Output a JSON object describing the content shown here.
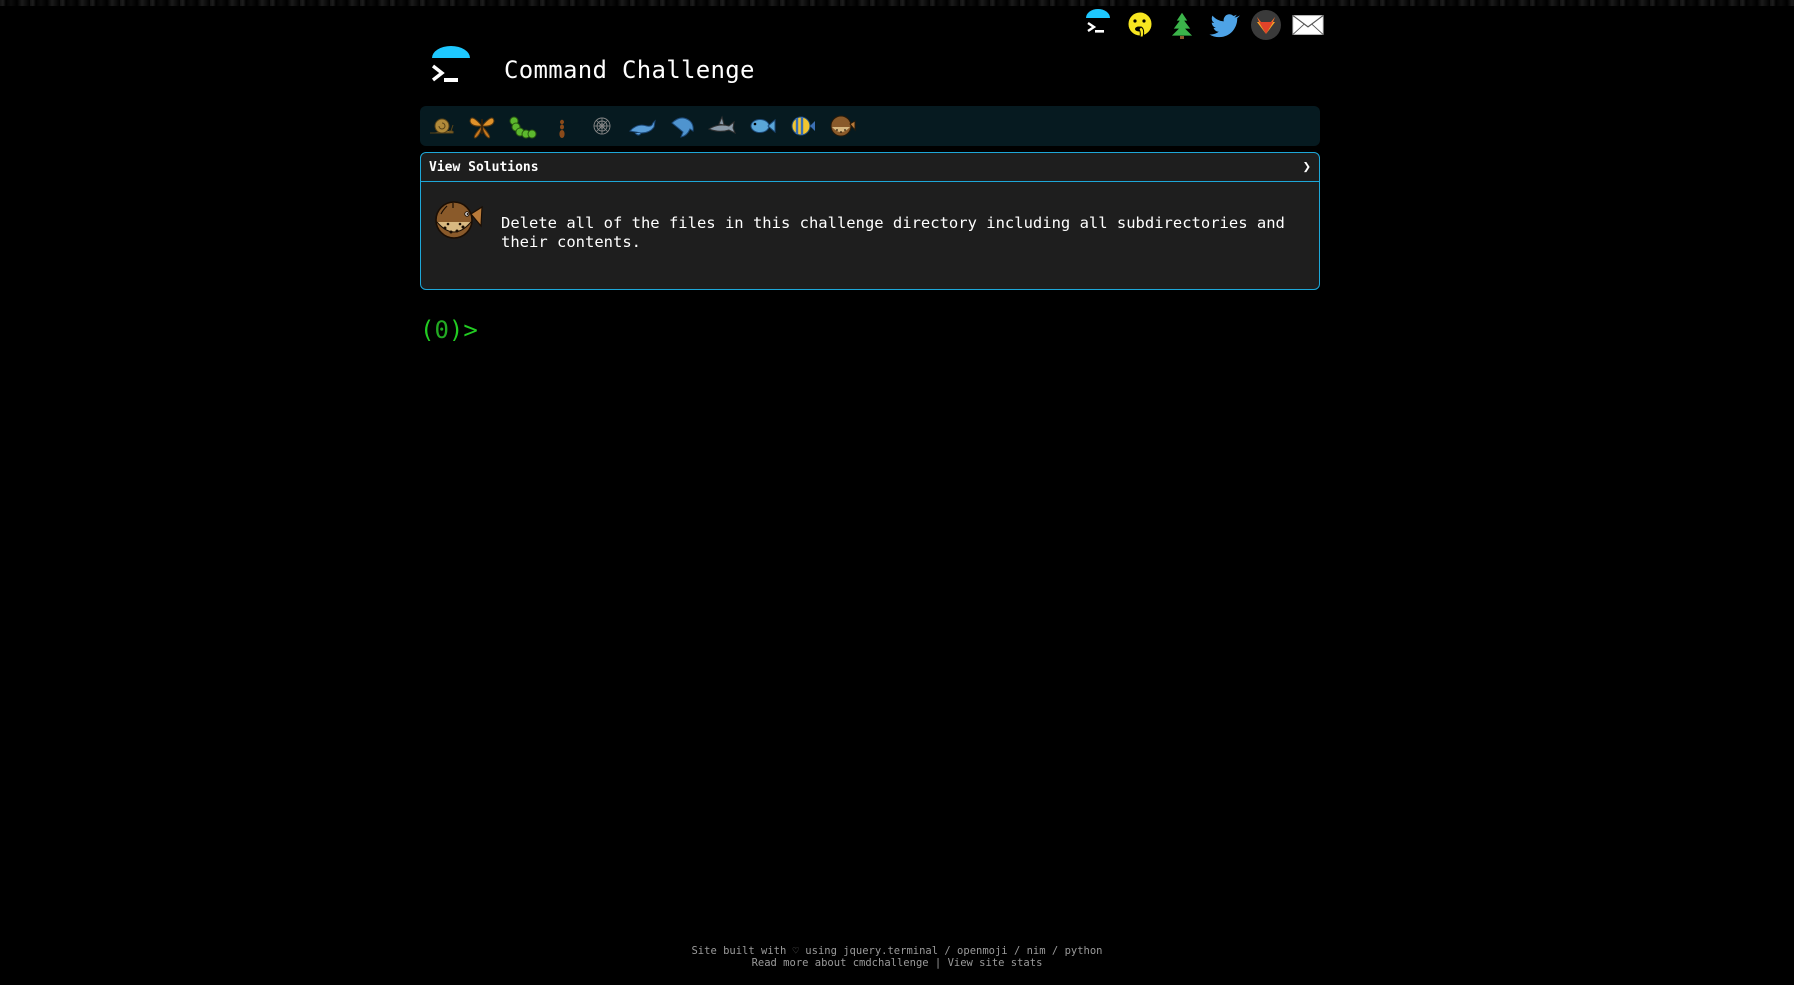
{
  "header": {
    "title": "Command Challenge"
  },
  "social": [
    {
      "name": "cmdchallenge-logo-icon"
    },
    {
      "name": "oops-face-icon"
    },
    {
      "name": "christmas-tree-icon"
    },
    {
      "name": "twitter-icon"
    },
    {
      "name": "gitlab-icon"
    },
    {
      "name": "email-icon"
    }
  ],
  "levels": [
    {
      "name": "snail-icon"
    },
    {
      "name": "butterfly-icon"
    },
    {
      "name": "caterpillar-icon"
    },
    {
      "name": "ant-icon"
    },
    {
      "name": "spider-web-icon"
    },
    {
      "name": "whale-icon"
    },
    {
      "name": "dolphin-icon"
    },
    {
      "name": "shark-icon"
    },
    {
      "name": "fish-icon"
    },
    {
      "name": "tropical-fish-icon"
    },
    {
      "name": "blowfish-icon"
    }
  ],
  "challenge": {
    "solutions_label": "View Solutions",
    "chevron": "❯",
    "description": "Delete all of the files in this challenge directory including all subdirectories and their contents."
  },
  "terminal": {
    "prompt_open": "(",
    "prompt_count": "0",
    "prompt_close": ")>"
  },
  "footer": {
    "line1_prefix": "Site built with",
    "heart": "♡",
    "line1_using": "using",
    "links": [
      "jquery.terminal",
      "openmoji",
      "nim",
      "python"
    ],
    "separator": "/",
    "read_more": "Read more about cmdchallenge",
    "pipe": "|",
    "stats": "View site stats"
  },
  "colors": {
    "accent": "#1ea7d8",
    "prompt": "#22cc22",
    "level_bar": "#061a20"
  }
}
